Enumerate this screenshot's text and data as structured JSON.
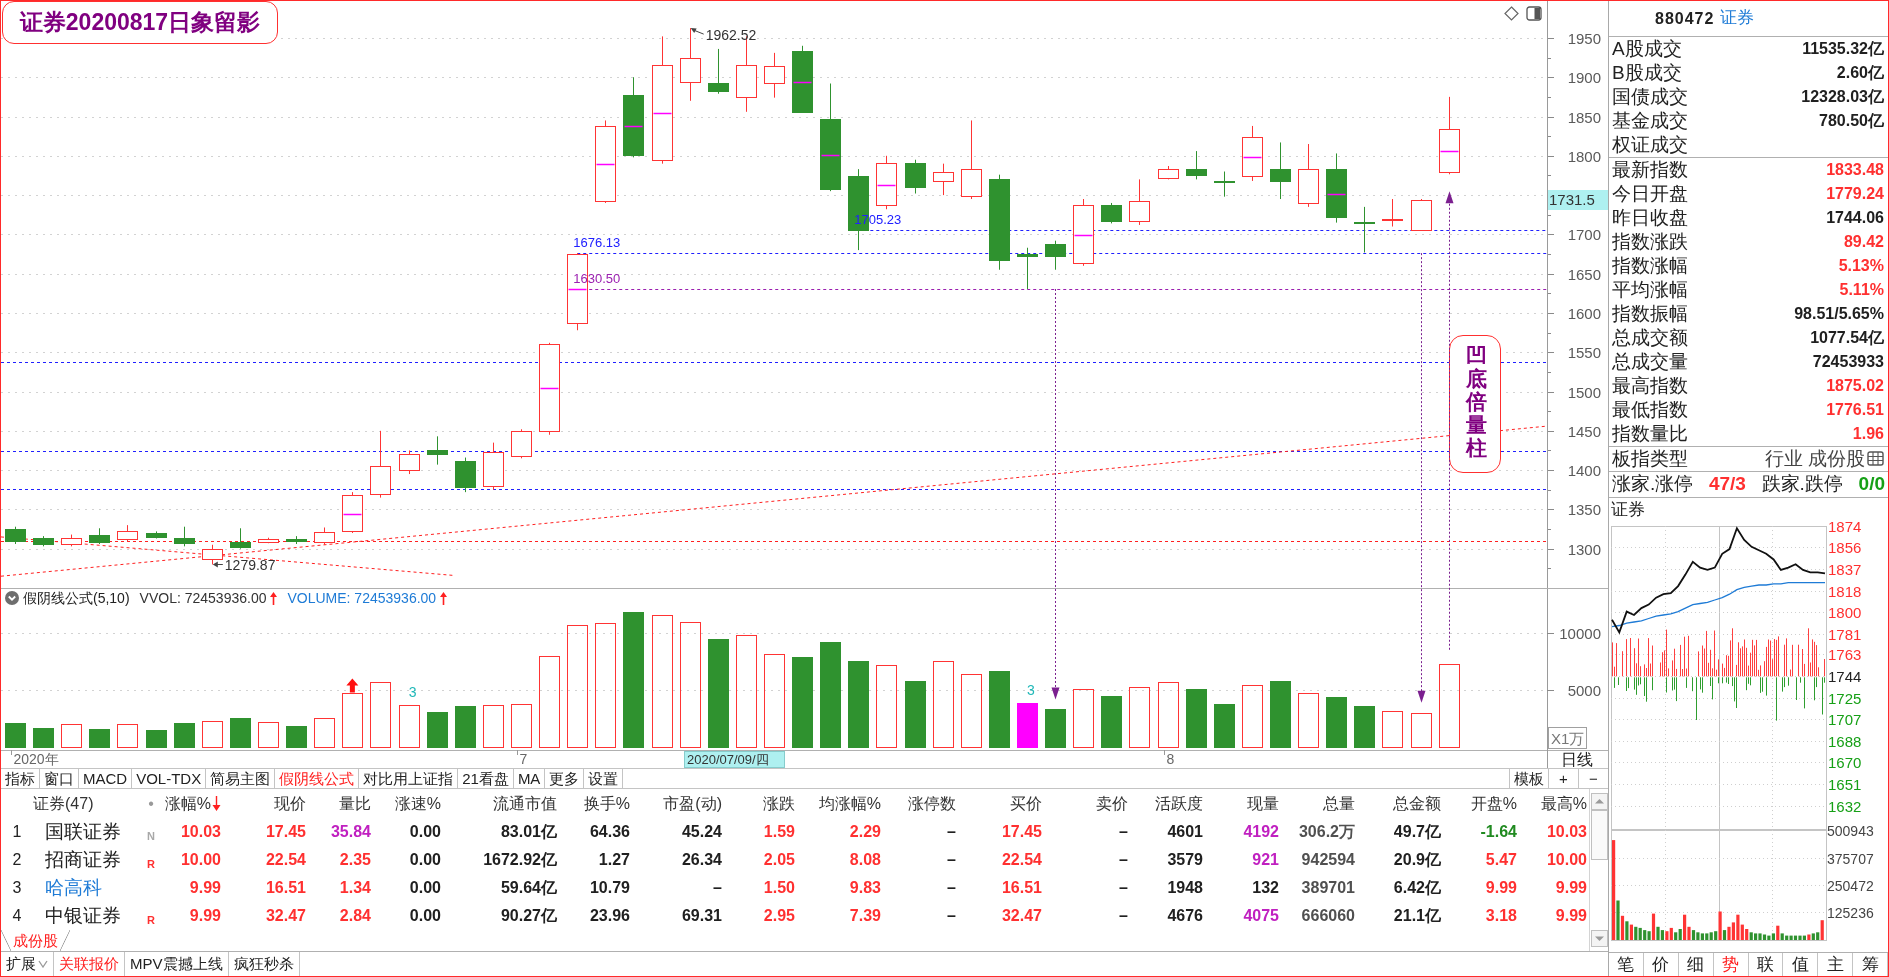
{
  "title_note": "证券20200817日象留影",
  "callout": "凹底倍量柱",
  "price_chart": {
    "axis_labels": [
      "1950",
      "1900",
      "1850",
      "1800",
      "1700",
      "1650",
      "1600",
      "1550",
      "1500",
      "1450",
      "1400",
      "1350",
      "1300"
    ],
    "price_labels": [
      "1962.52",
      "1279.87",
      "1676.13",
      "1630.50",
      "1705.23"
    ],
    "cursor_price": "1731.5"
  },
  "volume_panel": {
    "indicator": "假阴线公式(5,10)",
    "readouts": [
      {
        "label": "VVOL: 72453936.00",
        "color": "#333333",
        "arrow_up": true
      },
      {
        "label": "VOLUME: 72453936.00",
        "color": "#1e7bd6",
        "arrow_up": true
      }
    ],
    "count_labels": [
      "3",
      "3"
    ],
    "unit": "X1万",
    "chart_data": {
      "type": "bar",
      "ylim": [
        0,
        12280
      ],
      "yticks": [
        5000,
        10000
      ],
      "grid": true,
      "stacked": true,
      "series": [
        {
          "color": "#ff3434",
          "values": [
            null,
            null,
            2000,
            null,
            2000,
            null,
            null,
            2300,
            null,
            2200,
            null,
            2500,
            4700,
            5700,
            3700,
            null,
            null,
            3700,
            3800,
            8000,
            10700,
            10900,
            null,
            11600,
            11000,
            null,
            9800,
            8200,
            null,
            null,
            null,
            7200,
            null,
            7500,
            6400,
            null,
            null,
            null,
            5100,
            null,
            5300,
            5700,
            null,
            null,
            5400,
            null,
            4700,
            null,
            null,
            3200,
            3000,
            7300,
            null,
            null,
            null
          ]
        },
        {
          "color": "#2f922f",
          "values": [
            2100,
            1700,
            null,
            1600,
            null,
            1500,
            2100,
            null,
            2500,
            null,
            1800,
            null,
            null,
            null,
            null,
            3100,
            3600,
            null,
            null,
            null,
            null,
            null,
            11800,
            null,
            null,
            9500,
            null,
            null,
            7900,
            9200,
            7500,
            null,
            5800,
            null,
            null,
            6700,
            null,
            3300,
            null,
            4500,
            null,
            null,
            5100,
            3800,
            null,
            5800,
            null,
            4400,
            3600,
            null,
            null,
            null,
            null,
            null,
            null
          ]
        },
        {
          "color": "#ff00ff",
          "values": [
            null,
            null,
            null,
            null,
            null,
            null,
            null,
            null,
            null,
            null,
            null,
            null,
            null,
            null,
            null,
            null,
            null,
            null,
            null,
            null,
            null,
            null,
            null,
            null,
            null,
            null,
            null,
            null,
            null,
            null,
            null,
            null,
            null,
            null,
            null,
            null,
            3900,
            null,
            null,
            null,
            null,
            null,
            null,
            null,
            null,
            null,
            null,
            null,
            null,
            null,
            null,
            null,
            null,
            null,
            null
          ]
        }
      ]
    }
  },
  "date_axis": {
    "labels": [
      "2020年",
      "7",
      "8"
    ],
    "cursor": "2020/07/09/四"
  },
  "period": "日线",
  "toolbar_tabs": [
    {
      "label": "指标",
      "selected": false
    },
    {
      "label": "窗口",
      "selected": false
    },
    {
      "label": "MACD",
      "selected": false
    },
    {
      "label": "VOL-TDX",
      "selected": false
    },
    {
      "label": "简易主图",
      "selected": false
    },
    {
      "label": "假阴线公式",
      "selected": true
    },
    {
      "label": "对比用上证指",
      "selected": false
    },
    {
      "label": "21看盘",
      "selected": false
    },
    {
      "label": "MA",
      "selected": false
    },
    {
      "label": "更多",
      "selected": false
    },
    {
      "label": "设置",
      "selected": false
    }
  ],
  "template_button": "模板",
  "zoom_buttons": [
    "+",
    "−"
  ],
  "table": {
    "columns": [
      {
        "sorted": false
      },
      {
        "label": "证券(47)",
        "sorted": false
      },
      {
        "label": "•",
        "sorted": false
      },
      {
        "label": "涨幅%",
        "sorted": true
      },
      {
        "label": "现价",
        "sorted": false
      },
      {
        "label": "量比",
        "sorted": false
      },
      {
        "label": "涨速%",
        "sorted": false
      },
      {
        "label": "流通市值",
        "sorted": false
      },
      {
        "label": "换手%",
        "sorted": false
      },
      {
        "label": "市盈(动)",
        "sorted": false
      },
      {
        "label": "涨跌",
        "sorted": false
      },
      {
        "label": "均涨幅%",
        "sorted": false
      },
      {
        "label": "涨停数",
        "sorted": false
      },
      {
        "label": "买价",
        "sorted": false
      },
      {
        "label": "卖价",
        "sorted": false
      },
      {
        "label": "活跃度",
        "sorted": false
      },
      {
        "label": "现量",
        "sorted": false
      },
      {
        "label": "总量",
        "sorted": false
      },
      {
        "label": "总金额",
        "sorted": false
      },
      {
        "label": "开盘%",
        "sorted": false
      },
      {
        "label": "最高%",
        "sorted": false
      }
    ],
    "rows": [
      {
        "cells": [
          {
            "text": "1"
          },
          {
            "text": "国联证券",
            "color": "#202020"
          },
          {
            "text": "N",
            "color": "#a8a8a8"
          },
          {
            "text": "10.03",
            "color": "#ff3030"
          },
          {
            "text": "17.45",
            "color": "#ff3030"
          },
          {
            "text": "35.84",
            "color": "#c020c0"
          },
          {
            "text": "0.00",
            "color": "#202020"
          },
          {
            "text": "83.01亿",
            "color": "#202020"
          },
          {
            "text": "64.36",
            "color": "#202020"
          },
          {
            "text": "45.24",
            "color": "#202020"
          },
          {
            "text": "1.59",
            "color": "#ff3030"
          },
          {
            "text": "2.29",
            "color": "#ff3030"
          },
          {
            "text": "–",
            "color": "#202020"
          },
          {
            "text": "17.45",
            "color": "#ff3030"
          },
          {
            "text": "–",
            "color": "#202020"
          },
          {
            "text": "4601",
            "color": "#202020"
          },
          {
            "text": "4192",
            "color": "#c020c0"
          },
          {
            "text": "306.2万",
            "color": "#505050"
          },
          {
            "text": "49.7亿",
            "color": "#202020"
          },
          {
            "text": "-1.64",
            "color": "#208a20"
          },
          {
            "text": "10.03",
            "color": "#ff3030"
          }
        ]
      },
      {
        "cells": [
          {
            "text": "2"
          },
          {
            "text": "招商证券",
            "color": "#202020"
          },
          {
            "text": "R",
            "color": "#ff3030"
          },
          {
            "text": "10.00",
            "color": "#ff3030"
          },
          {
            "text": "22.54",
            "color": "#ff3030"
          },
          {
            "text": "2.35",
            "color": "#ff3030"
          },
          {
            "text": "0.00",
            "color": "#202020"
          },
          {
            "text": "1672.92亿",
            "color": "#202020"
          },
          {
            "text": "1.27",
            "color": "#202020"
          },
          {
            "text": "26.34",
            "color": "#202020"
          },
          {
            "text": "2.05",
            "color": "#ff3030"
          },
          {
            "text": "8.08",
            "color": "#ff3030"
          },
          {
            "text": "–",
            "color": "#202020"
          },
          {
            "text": "22.54",
            "color": "#ff3030"
          },
          {
            "text": "–",
            "color": "#202020"
          },
          {
            "text": "3579",
            "color": "#202020"
          },
          {
            "text": "921",
            "color": "#c020c0"
          },
          {
            "text": "942594",
            "color": "#505050"
          },
          {
            "text": "20.9亿",
            "color": "#202020"
          },
          {
            "text": "5.47",
            "color": "#ff3030"
          },
          {
            "text": "10.00",
            "color": "#ff3030"
          }
        ]
      },
      {
        "cells": [
          {
            "text": "3"
          },
          {
            "text": "哈高科",
            "color": "#1e7bd6"
          },
          {
            "text": ""
          },
          {
            "text": "9.99",
            "color": "#ff3030"
          },
          {
            "text": "16.51",
            "color": "#ff3030"
          },
          {
            "text": "1.34",
            "color": "#ff3030"
          },
          {
            "text": "0.00",
            "color": "#202020"
          },
          {
            "text": "59.64亿",
            "color": "#202020"
          },
          {
            "text": "10.79",
            "color": "#202020"
          },
          {
            "text": "–",
            "color": "#202020"
          },
          {
            "text": "1.50",
            "color": "#ff3030"
          },
          {
            "text": "9.83",
            "color": "#ff3030"
          },
          {
            "text": "–",
            "color": "#202020"
          },
          {
            "text": "16.51",
            "color": "#ff3030"
          },
          {
            "text": "–",
            "color": "#202020"
          },
          {
            "text": "1948",
            "color": "#202020"
          },
          {
            "text": "132",
            "color": "#202020"
          },
          {
            "text": "389701",
            "color": "#505050"
          },
          {
            "text": "6.42亿",
            "color": "#202020"
          },
          {
            "text": "9.99",
            "color": "#ff3030"
          },
          {
            "text": "9.99",
            "color": "#ff3030"
          }
        ]
      },
      {
        "cells": [
          {
            "text": "4"
          },
          {
            "text": "中银证券",
            "color": "#202020"
          },
          {
            "text": "R",
            "color": "#ff3030"
          },
          {
            "text": "9.99",
            "color": "#ff3030"
          },
          {
            "text": "32.47",
            "color": "#ff3030"
          },
          {
            "text": "2.84",
            "color": "#ff3030"
          },
          {
            "text": "0.00",
            "color": "#202020"
          },
          {
            "text": "90.27亿",
            "color": "#202020"
          },
          {
            "text": "23.96",
            "color": "#202020"
          },
          {
            "text": "69.31",
            "color": "#202020"
          },
          {
            "text": "2.95",
            "color": "#ff3030"
          },
          {
            "text": "7.39",
            "color": "#ff3030"
          },
          {
            "text": "–",
            "color": "#202020"
          },
          {
            "text": "32.47",
            "color": "#ff3030"
          },
          {
            "text": "–",
            "color": "#202020"
          },
          {
            "text": "4676",
            "color": "#202020"
          },
          {
            "text": "4075",
            "color": "#c020c0"
          },
          {
            "text": "666060",
            "color": "#505050"
          },
          {
            "text": "21.1亿",
            "color": "#202020"
          },
          {
            "text": "3.18",
            "color": "#ff3030"
          },
          {
            "text": "9.99",
            "color": "#ff3030"
          }
        ]
      }
    ]
  },
  "list_tabs": [
    {
      "label": "成份股",
      "selected": true
    }
  ],
  "bottom_tabs": [
    {
      "label": "扩展",
      "selected": false,
      "dropdown": true
    },
    {
      "label": "关联报价",
      "selected": true,
      "dropdown": false
    },
    {
      "label": "MPV震撼上线",
      "selected": false,
      "dropdown": false
    },
    {
      "label": "疯狂秒杀",
      "selected": false,
      "dropdown": false
    }
  ],
  "quote_panel": {
    "code": "880472",
    "name": "证券",
    "stat_groups": [
      {
        "rows": [
          {
            "label": "A股成交",
            "value": "11535.32亿",
            "color": "#202020"
          },
          {
            "label": "B股成交",
            "value": "2.60亿",
            "color": "#202020"
          },
          {
            "label": "国债成交",
            "value": "12328.03亿",
            "color": "#202020"
          },
          {
            "label": "基金成交",
            "value": "780.50亿",
            "color": "#202020"
          },
          {
            "label": "权证成交"
          }
        ]
      },
      {
        "rows": [
          {
            "label": "最新指数",
            "value": "1833.48",
            "color": "#ff3030"
          },
          {
            "label": "今日开盘",
            "value": "1779.24",
            "color": "#ff3030"
          },
          {
            "label": "昨日收盘",
            "value": "1744.06",
            "color": "#202020"
          },
          {
            "label": "指数涨跌",
            "value": "89.42",
            "color": "#ff3030"
          },
          {
            "label": "指数涨幅",
            "value": "5.13%",
            "color": "#ff3030"
          },
          {
            "label": "平均涨幅",
            "value": "5.11%",
            "color": "#ff3030"
          },
          {
            "label": "指数振幅",
            "value": "98.51/5.65%",
            "color": "#202020"
          },
          {
            "label": "总成交额",
            "value": "1077.54亿",
            "color": "#202020"
          },
          {
            "label": "总成交量",
            "value": "72453933",
            "color": "#202020"
          },
          {
            "label": "最高指数",
            "value": "1875.02",
            "color": "#ff3030"
          },
          {
            "label": "最低指数",
            "value": "1776.51",
            "color": "#ff3030"
          },
          {
            "label": "指数量比",
            "value": "1.96",
            "color": "#ff3030"
          }
        ]
      }
    ],
    "type_row": {
      "label": "板指类型",
      "value": "行业 成份股"
    },
    "breadth": [
      {
        "label": "涨家.涨停",
        "value": "47/3",
        "color": "#ff3030"
      },
      {
        "label": "跌家.跌停",
        "value": "0/0",
        "color": "#16a016"
      }
    ],
    "intraday_title": "证券",
    "intraday": {
      "chart_data": {
        "type": "line",
        "ylim": [
          1612,
          1874
        ],
        "yticks": [
          1874,
          1856,
          1837,
          1818,
          1800,
          1781,
          1763,
          1744,
          1725,
          1707,
          1688,
          1670,
          1651,
          1632
        ],
        "grid": true,
        "series": [
          {
            "color": "#111111",
            "values": [
              1793,
              1782,
              1800,
              1797,
              1803,
              1806,
              1812,
              1815,
              1816,
              1822,
              1832,
              1843,
              1838,
              1836,
              1838,
              1850,
              1854,
              1872,
              1862,
              1856,
              1853,
              1850,
              1845,
              1836,
              1838,
              1841,
              1836,
              1834,
              1834,
              1833
            ]
          },
          {
            "color": "#1e7bd6",
            "values": [
              1787,
              1788,
              1790,
              1791,
              1792,
              1794,
              1796,
              1797,
              1798,
              1800,
              1803,
              1806,
              1807,
              1808,
              1810,
              1812,
              1815,
              1819,
              1821,
              1822,
              1823,
              1823,
              1824,
              1824,
              1825,
              1825,
              1825,
              1825,
              1825,
              1825
            ]
          }
        ]
      }
    },
    "intraday_volume": {
      "chart_data": {
        "type": "bar",
        "ylim": [
          0,
          500943
        ],
        "yticks": [
          125236,
          250472,
          375707,
          500943
        ],
        "grid": true,
        "stacked": true,
        "series": [
          {
            "color": "#ff3434",
            "values": [
              455000,
              null,
              110000,
              null,
              70000,
              null,
              null,
              null,
              null,
              120000,
              null,
              null,
              40000,
              55000,
              null,
              null,
              115000,
              60000,
              null,
              null,
              null,
              null,
              null,
              null,
              130000,
              null,
              60000,
              80000,
              115000,
              70000,
              50000,
              null,
              null,
              null,
              null,
              null,
              null,
              65000,
              null,
              null,
              null,
              null,
              null,
              null,
              25000,
              null,
              null,
              90000
            ]
          },
          {
            "color": "#2f922f",
            "values": [
              null,
              180000,
              null,
              85000,
              null,
              60000,
              55000,
              45000,
              40000,
              null,
              60000,
              45000,
              null,
              null,
              35000,
              50000,
              null,
              null,
              45000,
              35000,
              30000,
              30000,
              35000,
              40000,
              null,
              45000,
              null,
              null,
              null,
              null,
              null,
              35000,
              30000,
              30000,
              25000,
              20000,
              30000,
              null,
              30000,
              20000,
              20000,
              20000,
              20000,
              20000,
              null,
              30000,
              35000,
              null
            ]
          }
        ]
      }
    },
    "tabs": [
      {
        "label": "笔",
        "selected": false
      },
      {
        "label": "价",
        "selected": false
      },
      {
        "label": "细",
        "selected": false
      },
      {
        "label": "势",
        "selected": true
      },
      {
        "label": "联",
        "selected": false
      },
      {
        "label": "值",
        "selected": false
      },
      {
        "label": "主",
        "selected": false
      },
      {
        "label": "筹",
        "selected": false
      }
    ]
  }
}
